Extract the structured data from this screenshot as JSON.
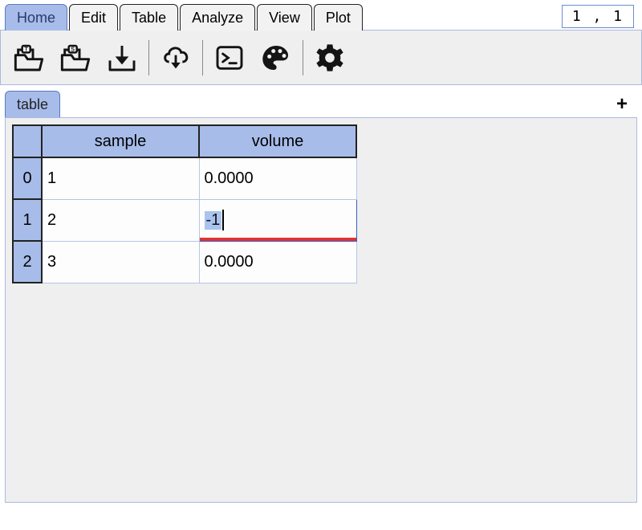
{
  "menu": {
    "tabs": [
      "Home",
      "Edit",
      "Table",
      "Analyze",
      "View",
      "Plot"
    ],
    "active_index": 0,
    "position_display": "1 , 1"
  },
  "toolbar": {
    "icons": [
      "open-text-icon",
      "open-script-icon",
      "save-icon",
      "cloud-download-icon",
      "console-icon",
      "palette-icon",
      "settings-icon"
    ]
  },
  "subtabs": {
    "items": [
      "table"
    ],
    "active_index": 0,
    "add_label": "+"
  },
  "table": {
    "columns": [
      "sample",
      "volume"
    ],
    "row_headers": [
      "0",
      "1",
      "2"
    ],
    "rows": [
      {
        "sample": "1",
        "volume": "0.0000"
      },
      {
        "sample": "2",
        "volume": "-1"
      },
      {
        "sample": "3",
        "volume": "0.0000"
      }
    ],
    "editing": {
      "row": 1,
      "col": 1,
      "has_error": true
    }
  }
}
